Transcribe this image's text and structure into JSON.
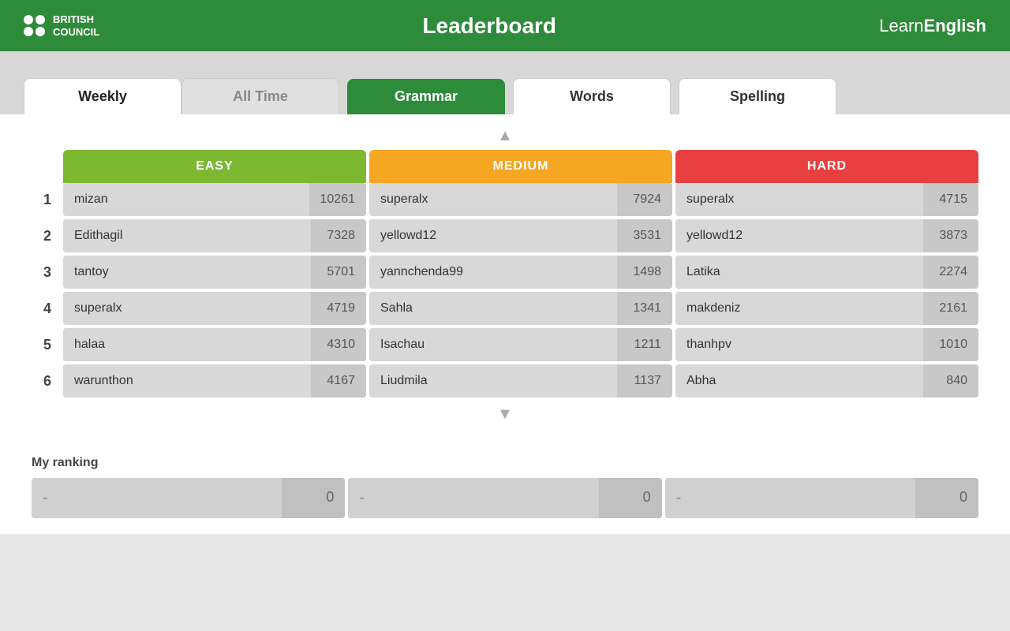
{
  "header": {
    "title": "Leaderboard",
    "logo_line1": "BRITISH",
    "logo_line2": "COUNCIL",
    "learn_english": "LearnEnglish"
  },
  "tabs": {
    "time": [
      {
        "label": "Weekly",
        "active": true
      },
      {
        "label": "All Time",
        "active": false
      }
    ],
    "category": [
      {
        "label": "Grammar",
        "active": true
      },
      {
        "label": "Words",
        "active": false
      },
      {
        "label": "Spelling",
        "active": false
      }
    ]
  },
  "difficulty_headers": {
    "easy": "EASY",
    "medium": "MEDIUM",
    "hard": "HARD"
  },
  "leaderboard": [
    {
      "rank": "1",
      "easy_name": "mizan",
      "easy_score": "10261",
      "medium_name": "superalx",
      "medium_score": "7924",
      "hard_name": "superalx",
      "hard_score": "4715"
    },
    {
      "rank": "2",
      "easy_name": "Edithagil",
      "easy_score": "7328",
      "medium_name": "yellowd12",
      "medium_score": "3531",
      "hard_name": "yellowd12",
      "hard_score": "3873"
    },
    {
      "rank": "3",
      "easy_name": "tantoy",
      "easy_score": "5701",
      "medium_name": "yannchenda99",
      "medium_score": "1498",
      "hard_name": "Latika",
      "hard_score": "2274"
    },
    {
      "rank": "4",
      "easy_name": "superalx",
      "easy_score": "4719",
      "medium_name": "Sahla",
      "medium_score": "1341",
      "hard_name": "makdeniz",
      "hard_score": "2161"
    },
    {
      "rank": "5",
      "easy_name": "halaa",
      "easy_score": "4310",
      "medium_name": "Isachau",
      "medium_score": "1211",
      "hard_name": "thanhpv",
      "hard_score": "1010"
    },
    {
      "rank": "6",
      "easy_name": "warunthon",
      "easy_score": "4167",
      "medium_name": "Liudmila",
      "medium_score": "1137",
      "hard_name": "Abha",
      "hard_score": "840"
    }
  ],
  "my_ranking": {
    "label": "My ranking",
    "easy_dash": "-",
    "easy_score": "0",
    "medium_dash": "-",
    "medium_score": "0",
    "hard_dash": "-",
    "hard_score": "0"
  },
  "arrows": {
    "up": "▲",
    "down": "▼"
  }
}
